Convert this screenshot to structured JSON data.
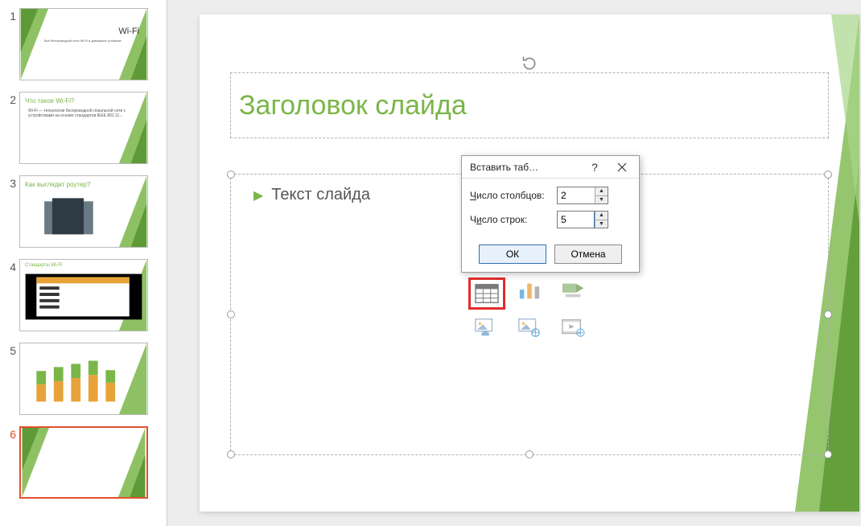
{
  "thumbnails": [
    {
      "num": "1",
      "title": "Wi-Fi",
      "body": "Всё беспроводной сети Wi-Fi в домашних условиях"
    },
    {
      "num": "2",
      "title": "Что такое Wi-Fi?",
      "body": "Wi-Fi — технология беспроводной локальной сети с устройствами на основе стандартов IEEE 802.11..."
    },
    {
      "num": "3",
      "title": "Как выглядит роутер?",
      "body": ""
    },
    {
      "num": "4",
      "title": "Стандарты Wi-Fi",
      "body": ""
    },
    {
      "num": "5",
      "title": "",
      "body": ""
    },
    {
      "num": "6",
      "title": "",
      "body": ""
    }
  ],
  "slide": {
    "title": "Заголовок слайда",
    "body_label": "Текст слайда"
  },
  "dialog": {
    "title": "Вставить таб…",
    "columns_label_pre": "Ч",
    "columns_label_rest": "исло столбцов:",
    "rows_label_pre": "Ч",
    "rows_label_mid": "и",
    "rows_label_rest": "сло строк:",
    "columns_value": "2",
    "rows_value": "5",
    "ok": "ОК",
    "cancel": "Отмена"
  },
  "content_icons": [
    "table-icon",
    "chart-icon",
    "smartart-icon",
    "picture-icon",
    "online-picture-icon",
    "video-icon"
  ],
  "colors": {
    "accent": "#7ab648",
    "highlight": "#e22c2c",
    "selected_thumb": "#e2502f"
  }
}
